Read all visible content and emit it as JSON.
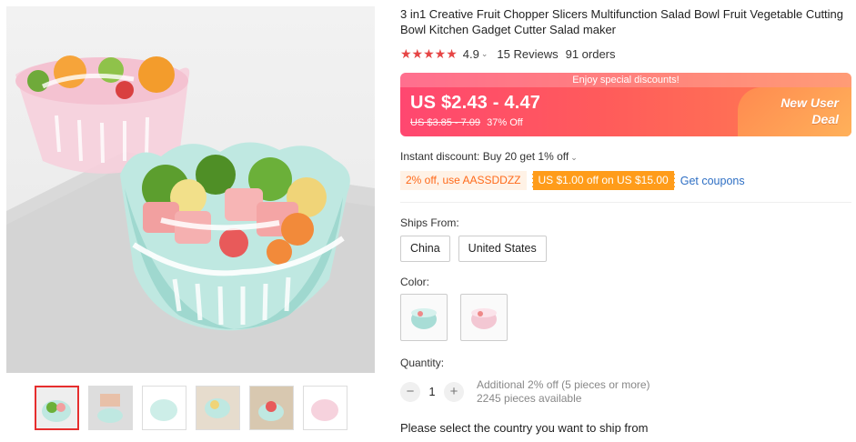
{
  "product": {
    "title": "3 in1 Creative Fruit Chopper Slicers Multifunction Salad Bowl Fruit Vegetable Cutting Bowl Kitchen Gadget Cutter Salad maker"
  },
  "rating": {
    "stars": "★★★★★",
    "value": "4.9",
    "reviews": "15 Reviews",
    "orders": "91 orders"
  },
  "price": {
    "promo_text": "Enjoy special discounts!",
    "current": "US $2.43 - 4.47",
    "original": "US $3.85 - 7.09",
    "discount": "37% Off",
    "badge_line1": "New User",
    "badge_line2": "Deal"
  },
  "instant_discount": "Instant discount: Buy 20 get 1% off",
  "coupons": {
    "coupon_code": "2% off, use AASSDDZZ",
    "store_coupon": "US $1.00 off on US $15.00",
    "get_link": "Get coupons"
  },
  "ships_from": {
    "label": "Ships From:",
    "options": [
      "China",
      "United States"
    ]
  },
  "color": {
    "label": "Color:",
    "options": [
      "mint",
      "pink"
    ]
  },
  "quantity": {
    "label": "Quantity:",
    "value": "1",
    "additional": "Additional 2% off (5 pieces or more)",
    "available": "2245 pieces available"
  },
  "ship_message": "Please select the country you want to ship from",
  "colors": {
    "accent": "#e62e2e",
    "mint": "#a8ddd6",
    "pink": "#f3c7d3",
    "link": "#2e6fc4"
  }
}
